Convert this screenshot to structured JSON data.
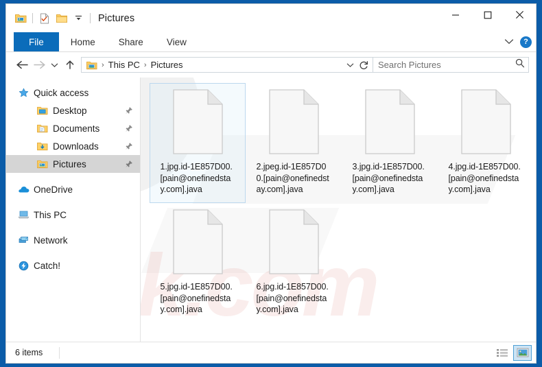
{
  "window": {
    "title": "Pictures",
    "quick_access": [
      {
        "name": "pictures-folder-icon",
        "label": "Pictures"
      },
      {
        "name": "properties-icon",
        "label": "Properties"
      },
      {
        "name": "new-folder-icon",
        "label": "New folder"
      },
      {
        "name": "customize-dropdown-icon",
        "label": "Customize Quick Access Toolbar"
      }
    ],
    "controls": {
      "minimize": "Minimize",
      "maximize": "Maximize",
      "close": "Close"
    }
  },
  "ribbon": {
    "tabs": [
      {
        "label": "File",
        "active": true
      },
      {
        "label": "Home",
        "active": false
      },
      {
        "label": "Share",
        "active": false
      },
      {
        "label": "View",
        "active": false
      }
    ],
    "collapse_label": "Minimize the Ribbon",
    "help_label": "?"
  },
  "addressbar": {
    "back_label": "Back",
    "forward_label": "Forward",
    "recent_label": "Recent locations",
    "up_label": "Up to This PC",
    "breadcrumbs": [
      "This PC",
      "Pictures"
    ],
    "separator": "›",
    "dropdown_label": "Previous Locations",
    "refresh_label": "Refresh Pictures"
  },
  "search": {
    "placeholder": "Search Pictures",
    "value": ""
  },
  "sidebar": {
    "items": [
      {
        "label": "Quick access",
        "icon": "star-icon",
        "level": "root",
        "pinned": false,
        "selected": false
      },
      {
        "label": "Desktop",
        "icon": "desktop-folder-icon",
        "level": "lvl1",
        "pinned": true,
        "selected": false
      },
      {
        "label": "Documents",
        "icon": "documents-folder-icon",
        "level": "lvl1",
        "pinned": true,
        "selected": false
      },
      {
        "label": "Downloads",
        "icon": "downloads-folder-icon",
        "level": "lvl1",
        "pinned": true,
        "selected": false
      },
      {
        "label": "Pictures",
        "icon": "pictures-folder-icon",
        "level": "lvl1",
        "pinned": true,
        "selected": true
      },
      {
        "label": "OneDrive",
        "icon": "onedrive-cloud-icon",
        "level": "root",
        "pinned": false,
        "selected": false,
        "gap_before": true
      },
      {
        "label": "This PC",
        "icon": "this-pc-icon",
        "level": "root",
        "pinned": false,
        "selected": false,
        "gap_before": true
      },
      {
        "label": "Network",
        "icon": "network-icon",
        "level": "root",
        "pinned": false,
        "selected": false,
        "gap_before": true
      },
      {
        "label": "Catch!",
        "icon": "catch-icon",
        "level": "root",
        "pinned": false,
        "selected": false,
        "gap_before": true
      }
    ]
  },
  "files": [
    {
      "name": "1.jpg.id-1E857D00.[pain@onefinedstay.com].java",
      "selected": true
    },
    {
      "name": "2.jpeg.id-1E857D00.[pain@onefinedstay.com].java",
      "selected": false
    },
    {
      "name": "3.jpg.id-1E857D00.[pain@onefinedstay.com].java",
      "selected": false
    },
    {
      "name": "4.jpg.id-1E857D00.[pain@onefinedstay.com].java",
      "selected": false
    },
    {
      "name": "5.jpg.id-1E857D00.[pain@onefinedstay.com].java",
      "selected": false
    },
    {
      "name": "6.jpg.id-1E857D00.[pain@onefinedstay.com].java",
      "selected": false
    }
  ],
  "statusbar": {
    "item_count": "6 items",
    "views": [
      {
        "name": "details-view-button",
        "label": "Details view",
        "active": false
      },
      {
        "name": "large-icons-view-button",
        "label": "Large icons view",
        "active": true
      }
    ]
  },
  "watermark": {
    "text": "risk.com"
  },
  "colors": {
    "frame_blue": "#0b5ca8",
    "tab_blue": "#0b6cba",
    "selection_border": "#bcd8ee",
    "sidebar_selected": "#d5d5d5"
  }
}
